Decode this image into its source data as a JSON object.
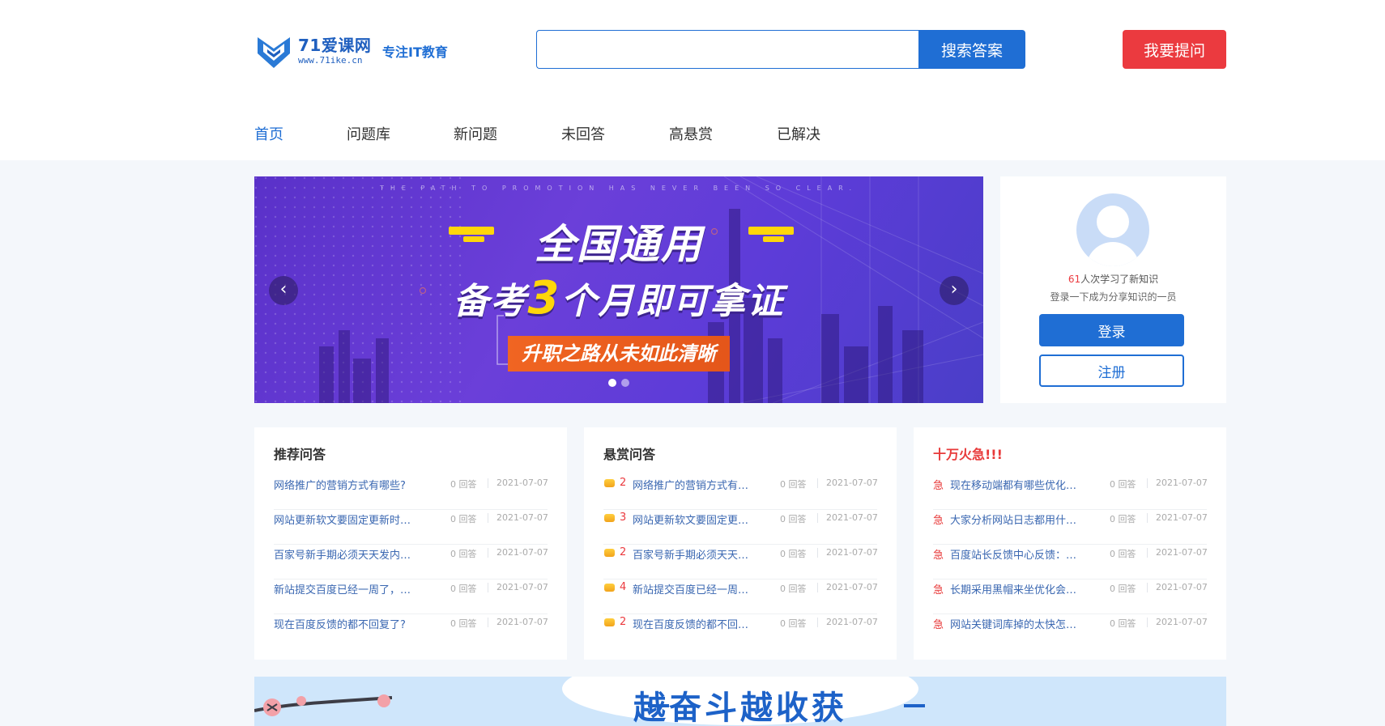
{
  "header": {
    "logo": {
      "name": "71爱课网",
      "url": "www.71ike.cn",
      "slogan": "专注IT教育"
    },
    "search": {
      "placeholder": "",
      "value": "",
      "button_label": "搜索答案"
    },
    "ask_button_label": "我要提问"
  },
  "nav": {
    "items": [
      "首页",
      "问题库",
      "新问题",
      "未回答",
      "高悬赏",
      "已解决"
    ],
    "active_index": 0
  },
  "banner": {
    "tagline": "THE PATH TO PROMOTION HAS NEVER BEEN SO CLEAR.",
    "title_line1": "全国通用",
    "title_line2_prefix": "备考",
    "title_line2_number": "3",
    "title_line2_suffix": "个月即可拿证",
    "subtitle": "升职之路从未如此清晰",
    "prev_icon": "chevron-left-icon",
    "next_icon": "chevron-right-icon",
    "slides_count": 2,
    "active_slide": 1
  },
  "login_card": {
    "learn_count": "61",
    "learn_text": "人次学习了新知识",
    "invite_text": "登录一下成为分享知识的一员",
    "login_label": "登录",
    "register_label": "注册"
  },
  "panels": [
    {
      "title": "推荐问答",
      "style": "normal",
      "items": [
        {
          "title": "网络推广的营销方式有哪些?",
          "answers": "0 回答",
          "date": "2021-07-07"
        },
        {
          "title": "网站更新软文要固定更新时…",
          "answers": "0 回答",
          "date": "2021-07-07"
        },
        {
          "title": "百家号新手期必须天天发内…",
          "answers": "0 回答",
          "date": "2021-07-07"
        },
        {
          "title": "新站提交百度已经一周了，…",
          "answers": "0 回答",
          "date": "2021-07-07"
        },
        {
          "title": "现在百度反馈的都不回复了?",
          "answers": "0 回答",
          "date": "2021-07-07"
        }
      ]
    },
    {
      "title": "悬赏问答",
      "style": "reward",
      "items": [
        {
          "reward": "2",
          "title": "网络推广的营销方式有…",
          "answers": "0 回答",
          "date": "2021-07-07"
        },
        {
          "reward": "3",
          "title": "网站更新软文要固定更…",
          "answers": "0 回答",
          "date": "2021-07-07"
        },
        {
          "reward": "2",
          "title": "百家号新手期必须天天…",
          "answers": "0 回答",
          "date": "2021-07-07"
        },
        {
          "reward": "4",
          "title": "新站提交百度已经一周…",
          "answers": "0 回答",
          "date": "2021-07-07"
        },
        {
          "reward": "2",
          "title": "现在百度反馈的都不回…",
          "answers": "0 回答",
          "date": "2021-07-07"
        }
      ]
    },
    {
      "title": "十万火急!!!",
      "style": "urgent",
      "urgent_mark": "急",
      "items": [
        {
          "title": "现在移动端都有哪些优化…",
          "answers": "0 回答",
          "date": "2021-07-07"
        },
        {
          "title": "大家分析网站日志都用什…",
          "answers": "0 回答",
          "date": "2021-07-07"
        },
        {
          "title": "百度站长反馈中心反馈：…",
          "answers": "0 回答",
          "date": "2021-07-07"
        },
        {
          "title": "长期采用黑帽来坐优化会…",
          "answers": "0 回答",
          "date": "2021-07-07"
        },
        {
          "title": "网站关键词库掉的太快怎…",
          "answers": "0 回答",
          "date": "2021-07-07"
        }
      ]
    }
  ],
  "bottom_banner": {
    "text": "越奋斗越收获"
  },
  "colors": {
    "brand_blue": "#1f6ed4",
    "ask_red": "#eb3a3f",
    "link_blue": "#3a67b1",
    "urgent_red": "#e83a3a",
    "banner_purple": "#5d3cd8"
  }
}
